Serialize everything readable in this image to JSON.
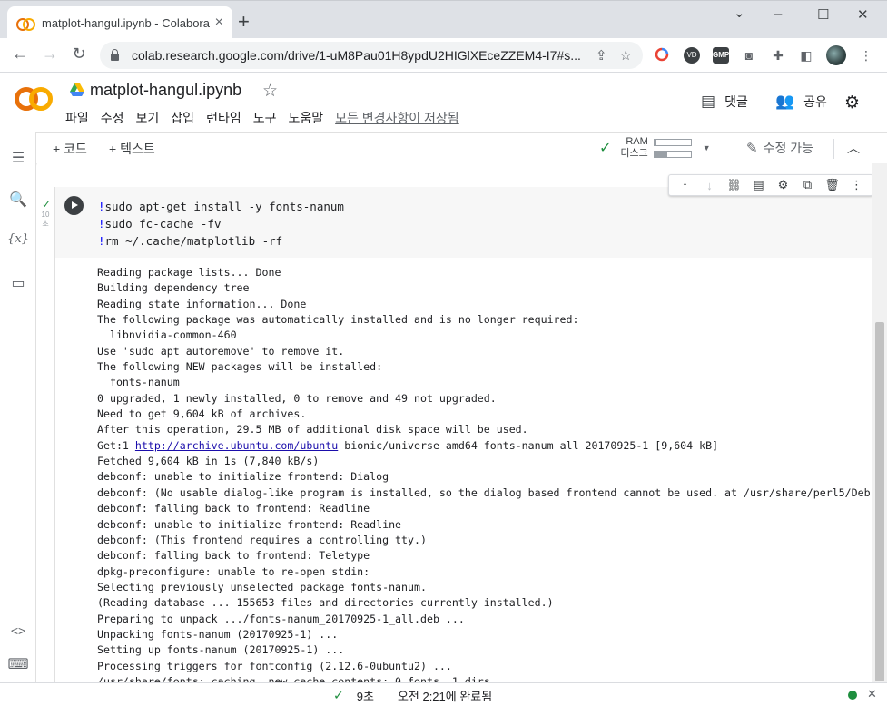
{
  "browser": {
    "tab_title": "matplot-hangul.ipynb - Colabora",
    "tab_close": "×",
    "new_tab": "+",
    "window_controls": {
      "minimize": "–",
      "maximize": "☐",
      "close": "✕",
      "tabsearch": "⌄"
    },
    "url": "colab.research.google.com/drive/1-uM8Pau01H8ypdU2HIGlXEceZZEM4-I7#s...",
    "extensions": [
      "colorful-dots-icon",
      "vd-icon",
      "gmp-icon",
      "camera-icon",
      "puzzle-icon",
      "sidepanel-icon",
      "avatar"
    ],
    "ext_labels": {
      "vd": "VD",
      "gmp": "GMP"
    }
  },
  "colab": {
    "notebook_title": "matplot-hangul.ipynb",
    "menu": [
      "파일",
      "수정",
      "보기",
      "삽입",
      "런타임",
      "도구",
      "도움말"
    ],
    "saved_status": "모든 변경사항이 저장됨",
    "comment_label": "댓글",
    "share_label": "공유"
  },
  "toolbar": {
    "add_code": "+ 코드",
    "add_text": "+ 텍스트",
    "ram_label": "RAM",
    "disk_label": "디스크",
    "ram_usage_fraction": 0.05,
    "disk_usage_fraction": 0.35,
    "edit_mode": "수정 가능"
  },
  "cell": {
    "exec_time": "10\n초",
    "code_lines": [
      {
        "bang": "!",
        "text": "sudo apt-get install -y fonts-nanum"
      },
      {
        "bang": "!",
        "text": "sudo fc-cache -fv"
      },
      {
        "bang": "!",
        "text": "rm ~/.cache/matplotlib -rf"
      }
    ],
    "output_lines": [
      "Reading package lists... Done",
      "Building dependency tree",
      "Reading state information... Done",
      "The following package was automatically installed and is no longer required:",
      "  libnvidia-common-460",
      "Use 'sudo apt autoremove' to remove it.",
      "The following NEW packages will be installed:",
      "  fonts-nanum",
      "0 upgraded, 1 newly installed, 0 to remove and 49 not upgraded.",
      "Need to get 9,604 kB of archives.",
      "After this operation, 29.5 MB of additional disk space will be used.",
      "__LINK__",
      "Fetched 9,604 kB in 1s (7,840 kB/s)",
      "debconf: unable to initialize frontend: Dialog",
      "debconf: (No usable dialog-like program is installed, so the dialog based frontend cannot be used. at /usr/share/perl5/Deb",
      "debconf: falling back to frontend: Readline",
      "debconf: unable to initialize frontend: Readline",
      "debconf: (This frontend requires a controlling tty.)",
      "debconf: falling back to frontend: Teletype",
      "dpkg-preconfigure: unable to re-open stdin:",
      "Selecting previously unselected package fonts-nanum.",
      "(Reading database ... 155653 files and directories currently installed.)",
      "Preparing to unpack .../fonts-nanum_20170925-1_all.deb ...",
      "Unpacking fonts-nanum (20170925-1) ...",
      "Setting up fonts-nanum (20170925-1) ...",
      "Processing triggers for fontconfig (2.12.6-0ubuntu2) ...",
      "/usr/share/fonts: caching, new cache contents: 0 fonts, 1 dirs"
    ],
    "link_line": {
      "prefix": "Get:1 ",
      "link": "http://archive.ubuntu.com/ubuntu",
      "suffix": " bionic/universe amd64 fonts-nanum all 20170925-1 [9,604 kB]"
    }
  },
  "statusbar": {
    "duration": "9초",
    "completed": "오전 2:21에 완료됨"
  }
}
